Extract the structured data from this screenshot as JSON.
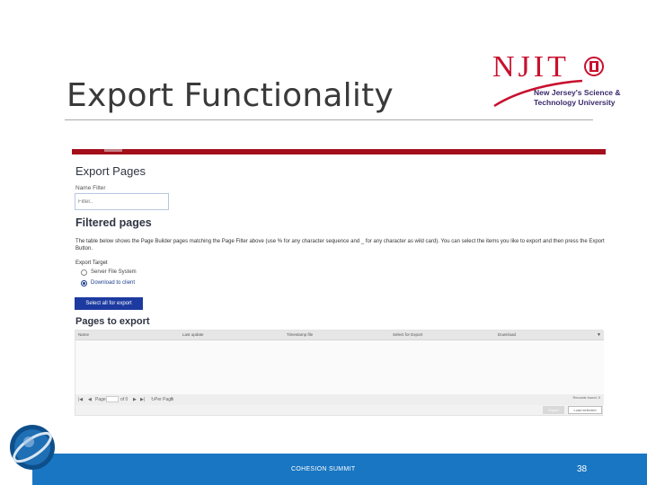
{
  "slide": {
    "title": "Export Functionality",
    "footer_text": "COHESION SUMMIT",
    "page_number": "38"
  },
  "logo": {
    "letters": "NJIT",
    "subtitle_line1": "New Jersey's Science &",
    "subtitle_line2": "Technology University",
    "brand_color": "#c8102e"
  },
  "screenshot": {
    "heading": "Export Pages",
    "name_filter_label": "Name Filter",
    "filter_placeholder": "Filter..",
    "filtered_heading": "Filtered pages",
    "description": "The table below shows the Page Builder pages matching the Page Filter above (use % for any character sequence and _ for any character as wild card). You can select the items you like to export and then press the Export Button.",
    "export_target_label": "Export Target",
    "options": [
      "Server File System",
      "Download to client"
    ],
    "selected_option": "Download to client",
    "select_all_button": "Select all for export",
    "pages_heading": "Pages to export",
    "columns": [
      "Name",
      "Last update",
      "Timestamp file",
      "Select for Export",
      "Download"
    ],
    "pager": {
      "page_label": "Page",
      "of_label": "of 0",
      "per_page_label": "Per Page",
      "per_page_value": "5",
      "records": "Records found: 0"
    },
    "export_button": "Export",
    "load_selected_button": "Load selected",
    "accent_color": "#1c3aa0",
    "topbar_color": "#a30f1b"
  },
  "footer": {
    "bar_color": "#1976c2"
  }
}
